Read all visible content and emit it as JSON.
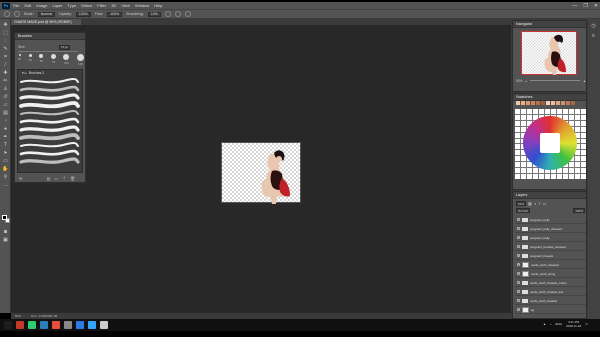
{
  "app": {
    "logo": "Ps"
  },
  "menu": [
    "File",
    "Edit",
    "Image",
    "Layer",
    "Type",
    "Select",
    "Filter",
    "3D",
    "View",
    "Window",
    "Help"
  ],
  "window_controls": [
    "—",
    "❐",
    "✕"
  ],
  "options": {
    "mode_label": "Mode:",
    "mode_value": "Normal",
    "opacity_label": "Opacity:",
    "opacity_value": "100%",
    "flow_label": "Flow:",
    "flow_value": "100%",
    "smoothing_label": "Smoothing:",
    "smoothing_value": "10%"
  },
  "document_tab": "CHARS MADE.psd @ 50% (RGB/8*)",
  "status": {
    "zoom": "50%",
    "doc_info": "Doc: 4.20M/266.4M"
  },
  "brushes_panel": {
    "title": "Brushes",
    "size_label": "Size:",
    "size_value": "73 px",
    "tip_sizes": [
      "30",
      "45",
      "60",
      "75",
      "100",
      "125"
    ],
    "folder_name": "Brushes 2",
    "stroke_count": 11
  },
  "navigator_panel": {
    "title": "Navigator",
    "zoom": "50%"
  },
  "swatches_panel": {
    "title": "Swatches",
    "recent_colors": [
      "#f2c6a8",
      "#e7b08c",
      "#d89a74",
      "#c9845e",
      "#b86e48",
      "#a65a38",
      "#f5d5c0",
      "#e9bea2",
      "#d9a888",
      "#c99270",
      "#ba7c58",
      "#a86642"
    ]
  },
  "layers_panel": {
    "title": "Layers",
    "kind_label": "Kind",
    "blend_mode": "Normal",
    "opacity": "100%",
    "layers": [
      {
        "name": "pregnant_belly",
        "type": "folder"
      },
      {
        "name": "pregnant_belly_dressed",
        "type": "folder"
      },
      {
        "name": "pregnant_belly",
        "type": "folder"
      },
      {
        "name": "pregnant_breasts_dressed",
        "type": "folder"
      },
      {
        "name": "pregnant_breasts",
        "type": "folder"
      },
      {
        "name": "nerds_cloth_dressed",
        "type": "layer"
      },
      {
        "name": "nerds_cloth_lining",
        "type": "layer"
      },
      {
        "name": "nerds_cloth_breasts_colors",
        "type": "folder"
      },
      {
        "name": "nerds_cloth_breasts_line",
        "type": "folder"
      },
      {
        "name": "nerds_cloth_breasts",
        "type": "folder"
      },
      {
        "name": "bg",
        "type": "layer"
      }
    ]
  },
  "taskbar": {
    "icons": [
      "#1e1e1e",
      "#c0392b",
      "#2ecc71",
      "#2980b9",
      "#e74c3c",
      "#888888",
      "#2c7be5",
      "#31a8ff",
      "#cccccc"
    ],
    "language": "ENG",
    "time": "4:21 PM",
    "date": "2018-11-18"
  }
}
